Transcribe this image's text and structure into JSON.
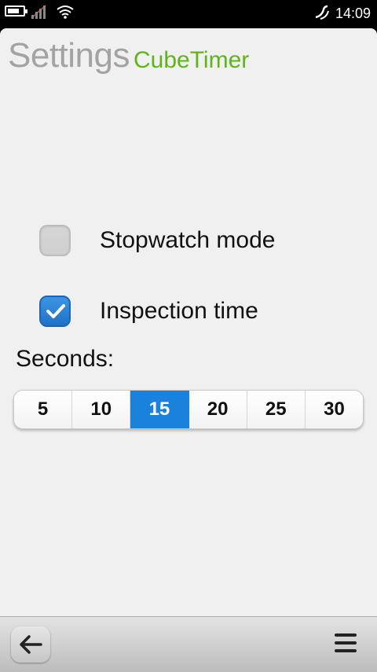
{
  "status_bar": {
    "time": "14:09",
    "icons": [
      "battery-icon",
      "signal-icon",
      "wifi-icon",
      "nfc-icon"
    ]
  },
  "header": {
    "title": "Settings",
    "subtitle": "CubeTimer"
  },
  "options": {
    "stopwatch": {
      "label": "Stopwatch mode",
      "checked": false
    },
    "inspection": {
      "label": "Inspection time",
      "checked": true
    }
  },
  "seconds": {
    "label": "Seconds:",
    "choices": [
      "5",
      "10",
      "15",
      "20",
      "25",
      "30"
    ],
    "selected": "15"
  },
  "toolbar": {
    "icons": [
      "back-arrow-icon",
      "menu-icon"
    ]
  },
  "colors": {
    "accent": "#1a82dc",
    "subtitle": "#5fb41a",
    "title": "#a3a3a3",
    "background": "#eff0ef"
  }
}
